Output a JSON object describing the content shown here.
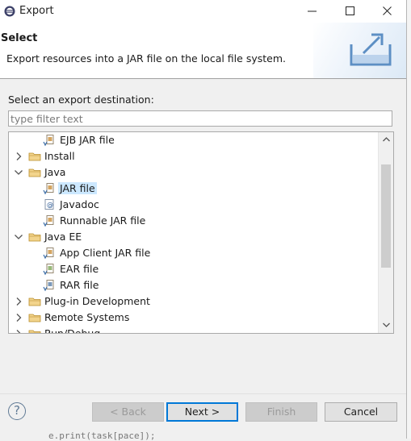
{
  "window": {
    "title": "Export"
  },
  "header": {
    "title": "Select",
    "description": "Export resources into a JAR file on the local file system."
  },
  "destination_label": "Select an export destination:",
  "filter": {
    "value": "",
    "placeholder": "type filter text"
  },
  "tree": [
    {
      "label": "EJB JAR file",
      "level": 1,
      "kind": "leaf",
      "icon": "ejb-jar-icon"
    },
    {
      "label": "Install",
      "level": 0,
      "kind": "collapsed",
      "icon": "folder-icon"
    },
    {
      "label": "Java",
      "level": 0,
      "kind": "expanded",
      "icon": "folder-icon"
    },
    {
      "label": "JAR file",
      "level": 1,
      "kind": "leaf",
      "icon": "jar-file-icon",
      "selected": true
    },
    {
      "label": "Javadoc",
      "level": 1,
      "kind": "leaf",
      "icon": "javadoc-icon"
    },
    {
      "label": "Runnable JAR file",
      "level": 1,
      "kind": "leaf",
      "icon": "runnable-jar-icon"
    },
    {
      "label": "Java EE",
      "level": 0,
      "kind": "expanded",
      "icon": "folder-icon"
    },
    {
      "label": "App Client JAR file",
      "level": 1,
      "kind": "leaf",
      "icon": "app-client-jar-icon"
    },
    {
      "label": "EAR file",
      "level": 1,
      "kind": "leaf",
      "icon": "ear-file-icon"
    },
    {
      "label": "RAR file",
      "level": 1,
      "kind": "leaf",
      "icon": "rar-file-icon"
    },
    {
      "label": "Plug-in Development",
      "level": 0,
      "kind": "collapsed",
      "icon": "folder-icon"
    },
    {
      "label": "Remote Systems",
      "level": 0,
      "kind": "collapsed",
      "icon": "folder-icon"
    },
    {
      "label": "Run/Debug",
      "level": 0,
      "kind": "collapsed",
      "icon": "folder-icon"
    }
  ],
  "buttons": {
    "back": "< Back",
    "next": "Next >",
    "finish": "Finish",
    "cancel": "Cancel"
  },
  "background_peek": "e.print(task[pace]);",
  "colors": {
    "selection": "#cce8ff",
    "default_button_border": "#0078d7",
    "folder": "#e8c26b"
  }
}
